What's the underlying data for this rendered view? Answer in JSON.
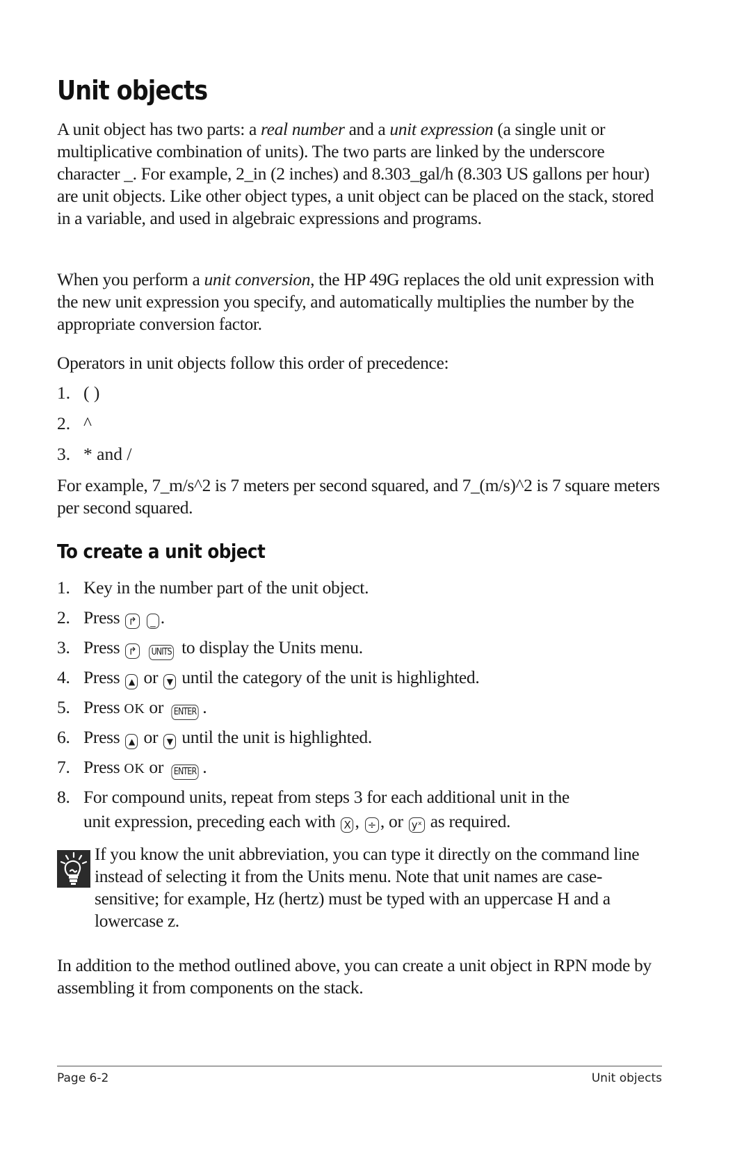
{
  "title": "Unit objects",
  "intro": {
    "p1_before_real": "A unit object has two parts: a ",
    "p1_real": "real number",
    "p1_mid": " and a ",
    "p1_unit": "unit expression",
    "p1_after": " (a single unit or multiplicative combination of units). The two parts are linked by the underscore character _. For example, 2_in (2 inches) and 8.303_gal/h (8.303 US gallons per hour) are unit objects. Like other object types, a unit object can be placed on the stack, stored in a variable, and used in algebraic expressions and programs.",
    "p2_before": "When you perform a ",
    "p2_em": "unit conversion",
    "p2_after": ", the HP 49G replaces the old unit expression with the new unit expression you specify, and automatically multiplies the number by the appropriate conversion factor.",
    "p3": "Operators in unit objects follow this order of precedence:"
  },
  "precedence": [
    {
      "num": "1.",
      "text": "( )"
    },
    {
      "num": "2.",
      "text": "^"
    },
    {
      "num": "3.",
      "text": "* and /"
    }
  ],
  "example_para": "For example, 7_m/s^2 is 7 meters per second squared, and 7_(m/s)^2 is 7 square meters per second squared.",
  "section_title": "To create a unit object",
  "steps": [
    {
      "num": "1.",
      "text": "Key in the number part of the unit object."
    },
    {
      "num": "2.",
      "pre": "Press",
      "key1": "↱",
      "key2": "_",
      "post": "."
    },
    {
      "num": "3.",
      "pre": "Press",
      "key1": "↱",
      "key2": "UNITS",
      "post": "to display the Units menu."
    },
    {
      "num": "4.",
      "pre": "Press",
      "key1": "▲",
      "mid": "or",
      "key2": "▼",
      "post": "until the category of the unit is highlighted."
    },
    {
      "num": "5.",
      "pre": "Press",
      "ok": "OK",
      "mid": "or",
      "key2": "ENTER",
      "post": "."
    },
    {
      "num": "6.",
      "pre": "Press",
      "key1": "▲",
      "mid": "or",
      "key2": "▼",
      "post": "until the unit is highlighted."
    },
    {
      "num": "7.",
      "pre": "Press",
      "ok": "OK",
      "mid": "or",
      "key2": "ENTER",
      "post": "."
    },
    {
      "num": "8.",
      "line1": "For compound units, repeat from steps 3 for each additional unit in the",
      "line2_pre": "unit expression, preceding each with",
      "key_x": "X",
      "key_div": "÷",
      "key_yx": "yˣ",
      "line2_post": "as required."
    }
  ],
  "tip": {
    "icon": "lightbulb-icon",
    "text": "If you know the unit abbreviation, you can type it directly on the command line instead of selecting it from the Units menu. Note that unit names are case-sensitive; for example, Hz (hertz) must be typed with an uppercase H and a lowercase z."
  },
  "closing_para": "In addition to the method outlined above, you can create a unit object in RPN mode by assembling it from components on the stack.",
  "footer": {
    "page": "Page 6-2",
    "section": "Unit objects"
  }
}
